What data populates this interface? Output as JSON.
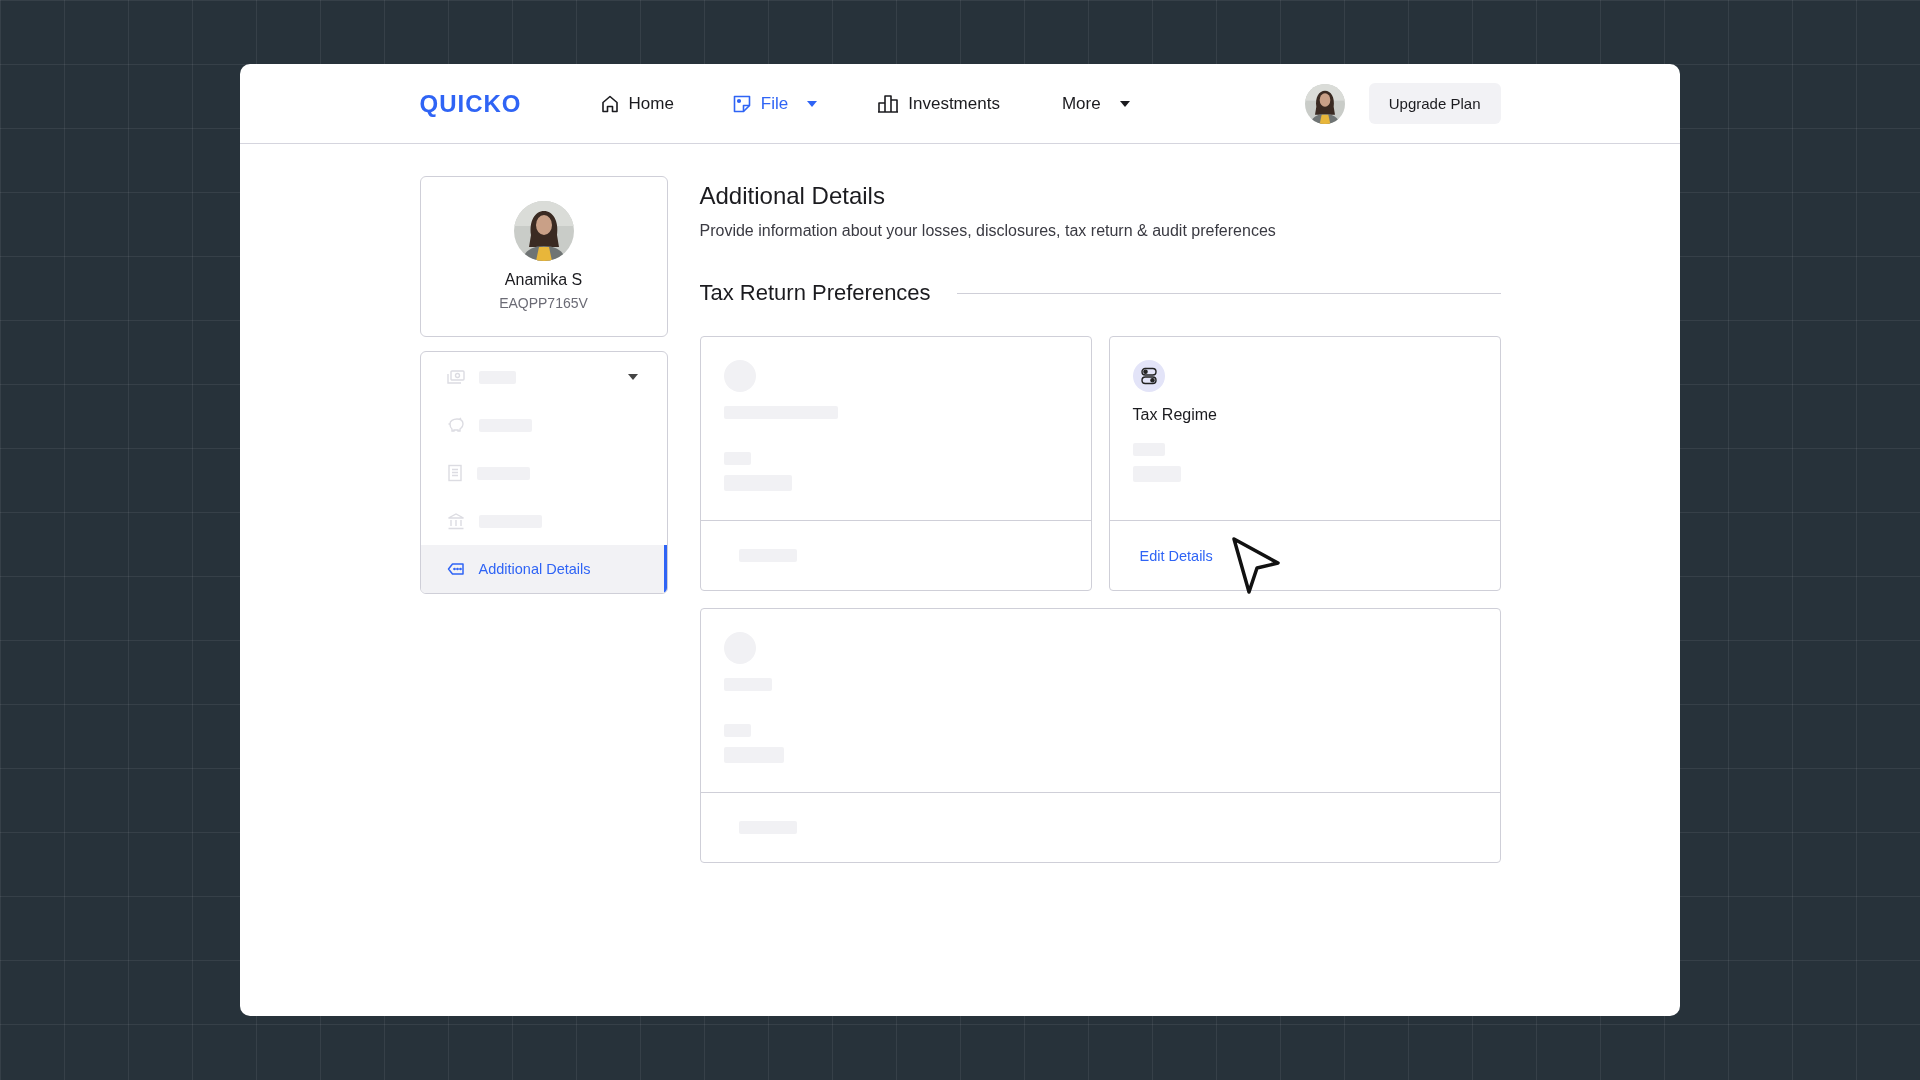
{
  "header": {
    "logo": "QUICKO",
    "nav": [
      {
        "label": "Home",
        "selected": false,
        "dropdown": false
      },
      {
        "label": "File",
        "selected": true,
        "dropdown": true
      },
      {
        "label": "Investments",
        "selected": false,
        "dropdown": false
      },
      {
        "label": "More",
        "selected": false,
        "dropdown": true
      }
    ],
    "upgrade_button": "Upgrade Plan"
  },
  "profile": {
    "name": "Anamika S",
    "pan": "EAQPP7165V"
  },
  "sidebar": {
    "items": [
      {
        "kind": "skeleton",
        "expandable": true,
        "selected": false
      },
      {
        "kind": "skeleton",
        "expandable": false,
        "selected": false
      },
      {
        "kind": "skeleton",
        "expandable": false,
        "selected": false
      },
      {
        "kind": "skeleton",
        "expandable": false,
        "selected": false
      },
      {
        "kind": "item",
        "label": "Additional Details",
        "expandable": false,
        "selected": true
      }
    ]
  },
  "main": {
    "title": "Additional Details",
    "subtitle": "Provide information about your losses, disclosures, tax return & audit preferences",
    "section": {
      "title": "Tax Return Preferences",
      "cards": [
        {
          "kind": "skeleton"
        },
        {
          "kind": "loaded",
          "title": "Tax Regime",
          "action": "Edit Details"
        },
        {
          "kind": "skeleton"
        }
      ]
    }
  }
}
